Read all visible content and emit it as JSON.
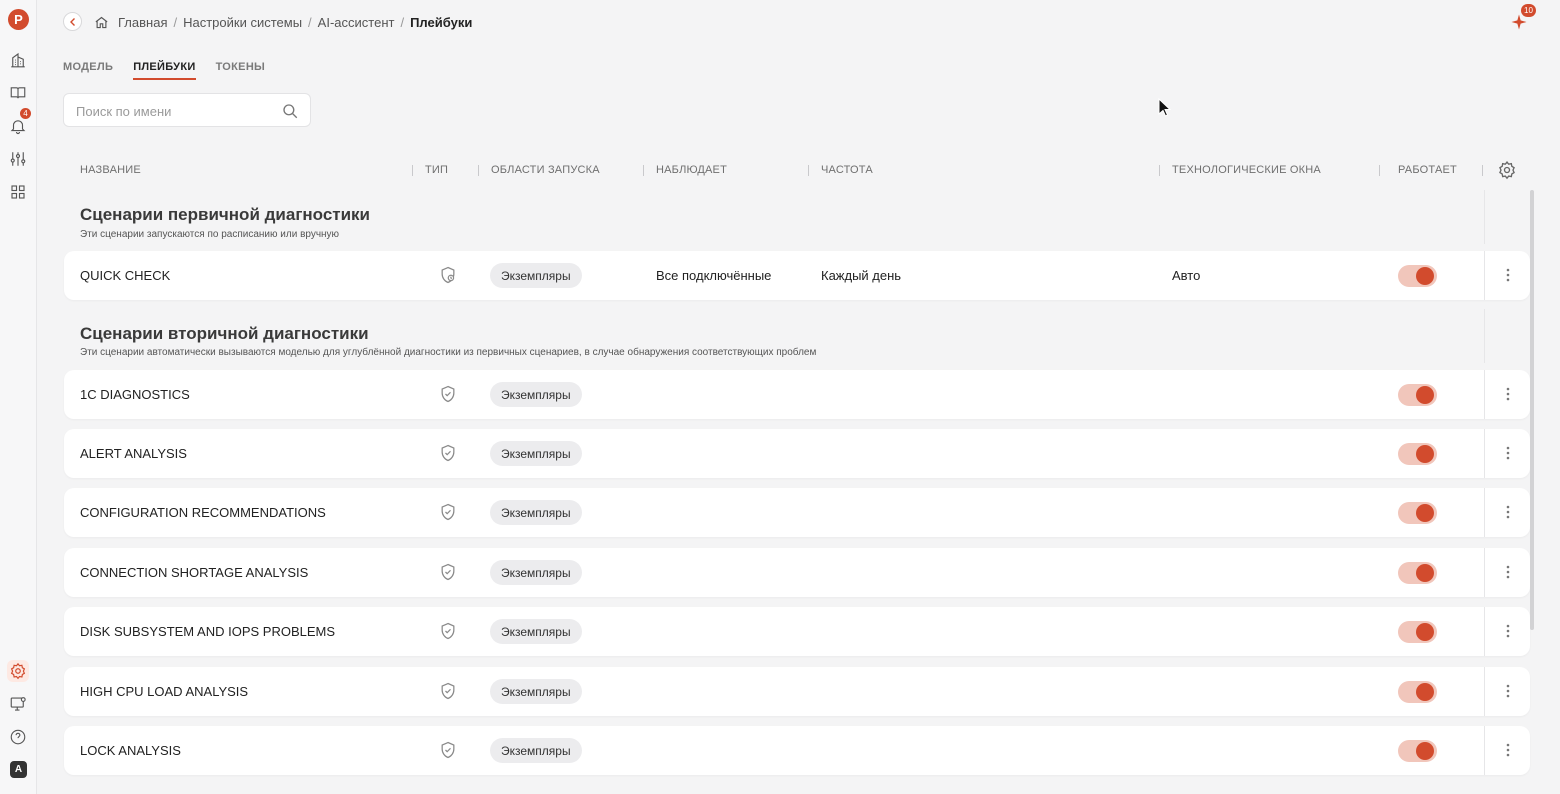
{
  "sidebar": {
    "logo": "P",
    "notification_count": "4",
    "user_initial": "A",
    "icons": [
      "building-icon",
      "book-icon",
      "bell-icon",
      "sliders-icon",
      "grid-icon",
      "settings-icon",
      "monitor-settings-icon",
      "help-icon"
    ]
  },
  "header": {
    "breadcrumb": [
      "Главная",
      "Настройки системы",
      "AI-ассистент",
      "Плейбуки"
    ],
    "ai_badge": "10"
  },
  "tabs": [
    {
      "label": "МОДЕЛЬ",
      "active": false
    },
    {
      "label": "ПЛЕЙБУКИ",
      "active": true
    },
    {
      "label": "ТОКЕНЫ",
      "active": false
    }
  ],
  "search": {
    "placeholder": "Поиск по имени",
    "value": ""
  },
  "columns": [
    "НАЗВАНИЕ",
    "ТИП",
    "ОБЛАСТИ ЗАПУСКА",
    "НАБЛЮДАЕТ",
    "ЧАСТОТА",
    "ТЕХНОЛОГИЧЕСКИЕ ОКНА",
    "РАБОТАЕТ"
  ],
  "sections": [
    {
      "title": "Сценарии первичной диагностики",
      "description": "Эти сценарии запускаются по расписанию или вручную",
      "rows": [
        {
          "name": "QUICK CHECK",
          "type_icon": "shield-clock-icon",
          "scope": "Экземпляры",
          "observes": "Все подключённые",
          "frequency": "Каждый день",
          "windows": "Авто",
          "enabled": true
        }
      ]
    },
    {
      "title": "Сценарии вторичной диагностики",
      "description": "Эти сценарии автоматически вызываются моделью для углублённой диагностики из первичных сценариев, в случае обнаружения соответствующих проблем",
      "rows": [
        {
          "name": "1C DIAGNOSTICS",
          "type_icon": "shield-check-icon",
          "scope": "Экземпляры",
          "observes": "",
          "frequency": "",
          "windows": "",
          "enabled": true
        },
        {
          "name": "ALERT ANALYSIS",
          "type_icon": "shield-check-icon",
          "scope": "Экземпляры",
          "observes": "",
          "frequency": "",
          "windows": "",
          "enabled": true
        },
        {
          "name": "CONFIGURATION RECOMMENDATIONS",
          "type_icon": "shield-check-icon",
          "scope": "Экземпляры",
          "observes": "",
          "frequency": "",
          "windows": "",
          "enabled": true
        },
        {
          "name": "CONNECTION SHORTAGE ANALYSIS",
          "type_icon": "shield-check-icon",
          "scope": "Экземпляры",
          "observes": "",
          "frequency": "",
          "windows": "",
          "enabled": true
        },
        {
          "name": "DISK SUBSYSTEM AND IOPS PROBLEMS",
          "type_icon": "shield-check-icon",
          "scope": "Экземпляры",
          "observes": "",
          "frequency": "",
          "windows": "",
          "enabled": true
        },
        {
          "name": "HIGH CPU LOAD ANALYSIS",
          "type_icon": "shield-check-icon",
          "scope": "Экземпляры",
          "observes": "",
          "frequency": "",
          "windows": "",
          "enabled": true
        },
        {
          "name": "LOCK ANALYSIS",
          "type_icon": "shield-check-icon",
          "scope": "Экземпляры",
          "observes": "",
          "frequency": "",
          "windows": "",
          "enabled": true
        }
      ]
    }
  ],
  "colors": {
    "accent": "#d24b2d",
    "toggle_track": "#f1c6bb",
    "chip_bg": "#ececee",
    "background": "#f4f4f5"
  }
}
